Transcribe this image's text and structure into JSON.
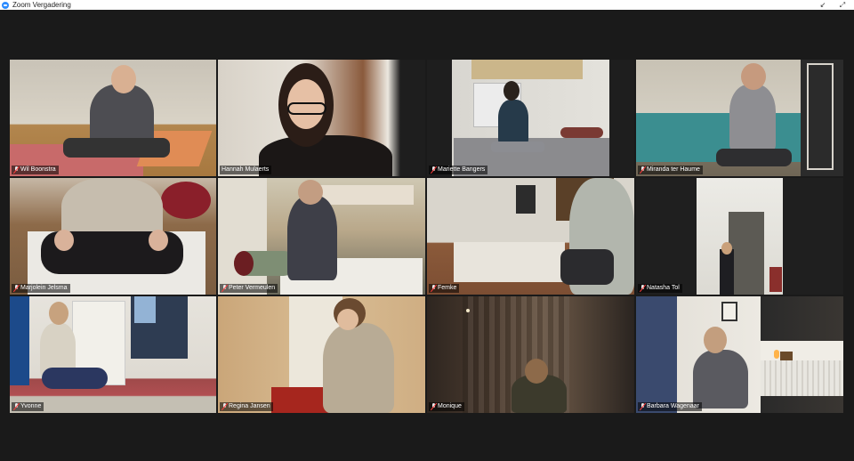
{
  "window": {
    "title": "Zoom Vergadering",
    "minimize_symbol": "↙",
    "maximize_symbol": "⤢"
  },
  "participants": [
    {
      "name": "Wil Boonstra",
      "muted": true
    },
    {
      "name": "Hannah Mulaerts",
      "muted": false,
      "active_speaker": true
    },
    {
      "name": "Mariette Bangers",
      "muted": true
    },
    {
      "name": "Miranda ter Haume",
      "muted": true
    },
    {
      "name": "Marjolein Jelsma",
      "muted": true
    },
    {
      "name": "Peter Vermeulen",
      "muted": true
    },
    {
      "name": "Femke",
      "muted": true
    },
    {
      "name": "Natasha Tol",
      "muted": true
    },
    {
      "name": "Yvonne",
      "muted": true
    },
    {
      "name": "Regina Jansen",
      "muted": true
    },
    {
      "name": "Monique",
      "muted": true
    },
    {
      "name": "Barbara Wagenaar",
      "muted": true
    }
  ],
  "colors": {
    "active_speaker_border": "#d7e04a",
    "background": "#1a1a1a",
    "muted_icon": "#ff3b3b"
  }
}
